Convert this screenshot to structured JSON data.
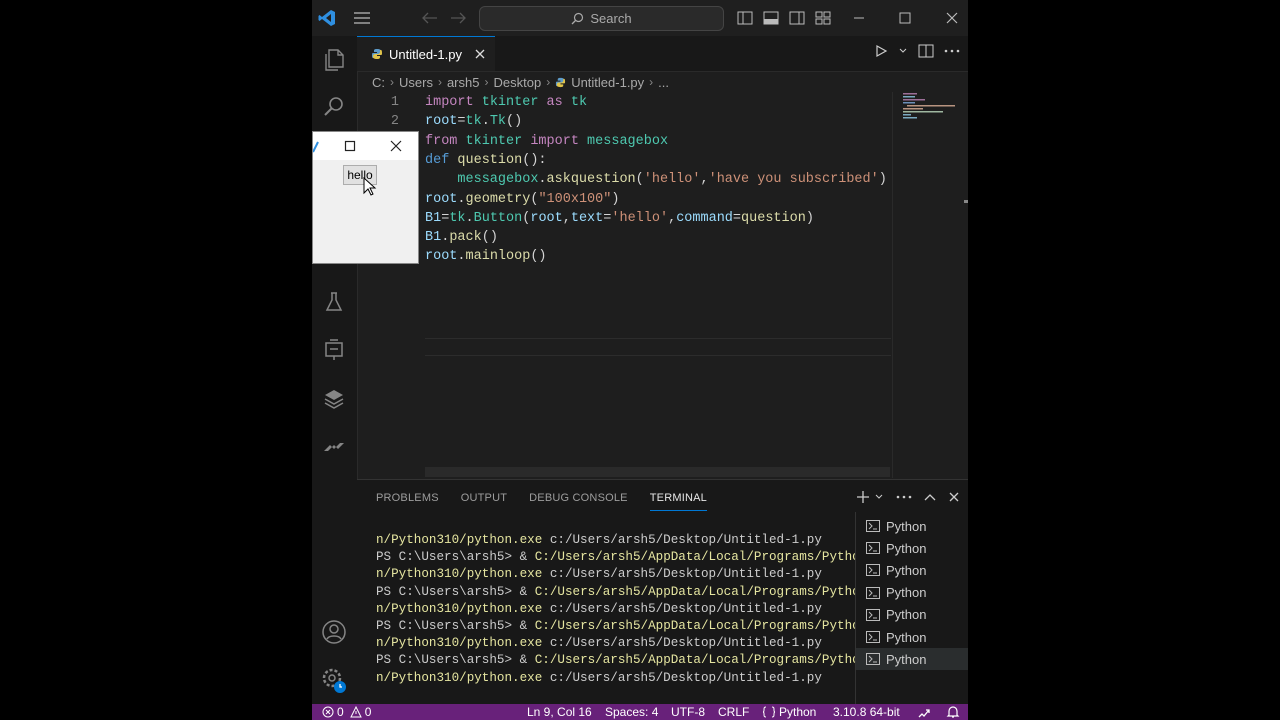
{
  "titlebar": {
    "search_label": "Search"
  },
  "tab": {
    "label": "Untitled-1.py"
  },
  "breadcrumb": {
    "items": [
      "C:",
      "Users",
      "arsh5",
      "Desktop",
      "Untitled-1.py",
      "..."
    ]
  },
  "editor": {
    "line_numbers": [
      "1",
      "2"
    ],
    "lines": [
      [
        [
          "kw",
          "import "
        ],
        [
          "mod",
          "tkinter "
        ],
        [
          "kw",
          "as "
        ],
        [
          "mod",
          "tk"
        ]
      ],
      [
        [
          "var",
          "root"
        ],
        [
          "plain",
          "="
        ],
        [
          "mod",
          "tk"
        ],
        [
          "plain",
          "."
        ],
        [
          "mod",
          "Tk"
        ],
        [
          "plain",
          "()"
        ]
      ],
      [
        [
          "kw",
          "from "
        ],
        [
          "mod",
          "tkinter "
        ],
        [
          "kw",
          "import "
        ],
        [
          "mod",
          "messagebox"
        ]
      ],
      [
        [
          "def",
          "def "
        ],
        [
          "fn",
          "question"
        ],
        [
          "plain",
          "():"
        ]
      ],
      [
        [
          "plain",
          "    "
        ],
        [
          "mod",
          "messagebox"
        ],
        [
          "plain",
          "."
        ],
        [
          "fn",
          "askquestion"
        ],
        [
          "plain",
          "("
        ],
        [
          "str",
          "'hello'"
        ],
        [
          "plain",
          ","
        ],
        [
          "str",
          "'have you subscribed'"
        ],
        [
          "plain",
          ")"
        ]
      ],
      [
        [
          "var",
          "root"
        ],
        [
          "plain",
          "."
        ],
        [
          "fn",
          "geometry"
        ],
        [
          "plain",
          "("
        ],
        [
          "str",
          "\"100x100\""
        ],
        [
          "plain",
          ")"
        ]
      ],
      [
        [
          "var",
          "B1"
        ],
        [
          "plain",
          "="
        ],
        [
          "mod",
          "tk"
        ],
        [
          "plain",
          "."
        ],
        [
          "mod",
          "Button"
        ],
        [
          "plain",
          "("
        ],
        [
          "var",
          "root"
        ],
        [
          "plain",
          ","
        ],
        [
          "var",
          "text"
        ],
        [
          "plain",
          "="
        ],
        [
          "str",
          "'hello'"
        ],
        [
          "plain",
          ","
        ],
        [
          "var",
          "command"
        ],
        [
          "plain",
          "="
        ],
        [
          "fn",
          "question"
        ],
        [
          "plain",
          ")"
        ]
      ],
      [
        [
          "var",
          "B1"
        ],
        [
          "plain",
          "."
        ],
        [
          "fn",
          "pack"
        ],
        [
          "plain",
          "()"
        ]
      ],
      [
        [
          "var",
          "root"
        ],
        [
          "plain",
          "."
        ],
        [
          "fn",
          "mainloop"
        ],
        [
          "plain",
          "()"
        ]
      ]
    ]
  },
  "panel": {
    "tabs": [
      "PROBLEMS",
      "OUTPUT",
      "DEBUG CONSOLE",
      "TERMINAL"
    ],
    "active_tab": "TERMINAL",
    "terminal_lines": [
      {
        "prefix": "",
        "path": "n/Python310/python.exe",
        "rest": " c:/Users/arsh5/Desktop/Untitled-1.py"
      },
      {
        "prefix": "PS C:\\Users\\arsh5> & ",
        "path": "C:/Users/arsh5/AppData/Local/Programs/Pytho",
        "rest": ""
      },
      {
        "prefix": "",
        "path": "n/Python310/python.exe",
        "rest": " c:/Users/arsh5/Desktop/Untitled-1.py"
      },
      {
        "prefix": "PS C:\\Users\\arsh5> & ",
        "path": "C:/Users/arsh5/AppData/Local/Programs/Pytho",
        "rest": ""
      },
      {
        "prefix": "",
        "path": "n/Python310/python.exe",
        "rest": " c:/Users/arsh5/Desktop/Untitled-1.py"
      },
      {
        "prefix": "PS C:\\Users\\arsh5> & ",
        "path": "C:/Users/arsh5/AppData/Local/Programs/Pytho",
        "rest": ""
      },
      {
        "prefix": "",
        "path": "n/Python310/python.exe",
        "rest": " c:/Users/arsh5/Desktop/Untitled-1.py"
      },
      {
        "prefix": "PS C:\\Users\\arsh5> & ",
        "path": "C:/Users/arsh5/AppData/Local/Programs/Pytho",
        "rest": ""
      },
      {
        "prefix": "",
        "path": "n/Python310/python.exe",
        "rest": " c:/Users/arsh5/Desktop/Untitled-1.py"
      }
    ],
    "terminal_instances": [
      "Python",
      "Python",
      "Python",
      "Python",
      "Python",
      "Python",
      "Python"
    ]
  },
  "statusbar": {
    "errors": "0",
    "warnings": "0",
    "position": "Ln 9, Col 16",
    "spaces": "Spaces: 4",
    "encoding": "UTF-8",
    "eol": "CRLF",
    "language": "Python",
    "interpreter": "3.10.8 64-bit"
  },
  "tk_window": {
    "button_label": "hello"
  },
  "colors": {
    "statusbar_bg": "#68217a",
    "accent": "#0078d4",
    "editor_bg": "#1e1e1e"
  },
  "icons": {
    "activity": [
      "explorer-icon",
      "search-icon",
      "testing-icon",
      "remote-explorer-icon",
      "extensions-icon",
      "azure-icon",
      "accounts-icon",
      "manage-icon"
    ]
  }
}
